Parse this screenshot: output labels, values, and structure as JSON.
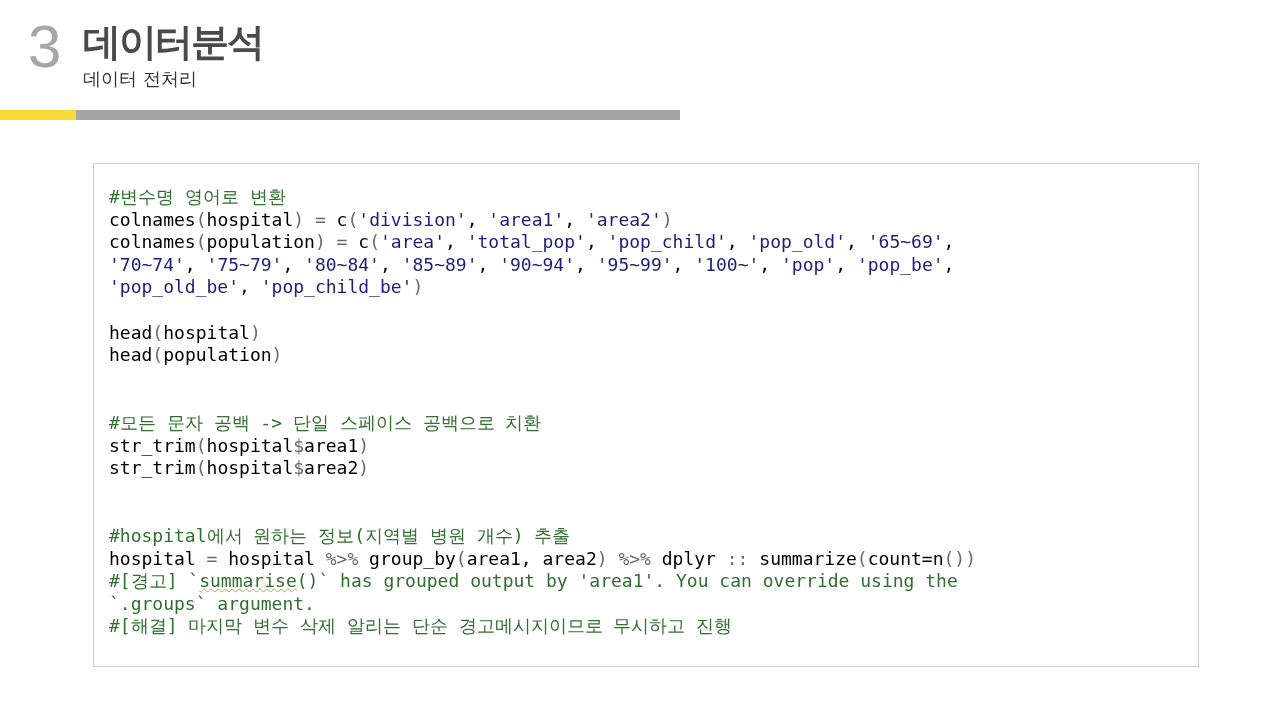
{
  "header": {
    "number": "3",
    "title": "데이터분석",
    "subtitle": "데이터 전처리"
  },
  "code": {
    "lines": [
      {
        "kind": "code",
        "tokens": [
          {
            "kind": "comment",
            "text": "#변수명 영어로 변환"
          }
        ]
      },
      {
        "kind": "code",
        "tokens": [
          {
            "kind": "plain",
            "text": "colnames"
          },
          {
            "kind": "op",
            "text": "("
          },
          {
            "kind": "plain",
            "text": "hospital"
          },
          {
            "kind": "op",
            "text": ") = "
          },
          {
            "kind": "plain",
            "text": "c"
          },
          {
            "kind": "op",
            "text": "("
          },
          {
            "kind": "string",
            "text": "'division'"
          },
          {
            "kind": "plain",
            "text": ", "
          },
          {
            "kind": "string",
            "text": "'area1'"
          },
          {
            "kind": "plain",
            "text": ", "
          },
          {
            "kind": "string",
            "text": "'area2'"
          },
          {
            "kind": "op",
            "text": ")"
          }
        ]
      },
      {
        "kind": "code",
        "tokens": [
          {
            "kind": "plain",
            "text": "colnames"
          },
          {
            "kind": "op",
            "text": "("
          },
          {
            "kind": "plain",
            "text": "population"
          },
          {
            "kind": "op",
            "text": ") = "
          },
          {
            "kind": "plain",
            "text": "c"
          },
          {
            "kind": "op",
            "text": "("
          },
          {
            "kind": "string",
            "text": "'area'"
          },
          {
            "kind": "plain",
            "text": ", "
          },
          {
            "kind": "string",
            "text": "'total_pop'"
          },
          {
            "kind": "plain",
            "text": ", "
          },
          {
            "kind": "string",
            "text": "'pop_child'"
          },
          {
            "kind": "plain",
            "text": ", "
          },
          {
            "kind": "string",
            "text": "'pop_old'"
          },
          {
            "kind": "plain",
            "text": ", "
          },
          {
            "kind": "string",
            "text": "'65~69'"
          },
          {
            "kind": "plain",
            "text": ","
          }
        ]
      },
      {
        "kind": "code",
        "tokens": [
          {
            "kind": "string",
            "text": "'70~74'"
          },
          {
            "kind": "plain",
            "text": ", "
          },
          {
            "kind": "string",
            "text": "'75~79'"
          },
          {
            "kind": "plain",
            "text": ", "
          },
          {
            "kind": "string",
            "text": "'80~84'"
          },
          {
            "kind": "plain",
            "text": ", "
          },
          {
            "kind": "string",
            "text": "'85~89'"
          },
          {
            "kind": "plain",
            "text": ", "
          },
          {
            "kind": "string",
            "text": "'90~94'"
          },
          {
            "kind": "plain",
            "text": ", "
          },
          {
            "kind": "string",
            "text": "'95~99'"
          },
          {
            "kind": "plain",
            "text": ", "
          },
          {
            "kind": "string",
            "text": "'100~'"
          },
          {
            "kind": "plain",
            "text": ", "
          },
          {
            "kind": "string",
            "text": "'pop'"
          },
          {
            "kind": "plain",
            "text": ", "
          },
          {
            "kind": "string",
            "text": "'pop_be'"
          },
          {
            "kind": "plain",
            "text": ","
          }
        ]
      },
      {
        "kind": "code",
        "tokens": [
          {
            "kind": "string",
            "text": "'pop_old_be'"
          },
          {
            "kind": "plain",
            "text": ", "
          },
          {
            "kind": "string",
            "text": "'pop_child_be'"
          },
          {
            "kind": "op",
            "text": ")"
          }
        ]
      },
      {
        "kind": "blank"
      },
      {
        "kind": "code",
        "tokens": [
          {
            "kind": "plain",
            "text": "head"
          },
          {
            "kind": "op",
            "text": "("
          },
          {
            "kind": "plain",
            "text": "hospital"
          },
          {
            "kind": "op",
            "text": ")"
          }
        ]
      },
      {
        "kind": "code",
        "tokens": [
          {
            "kind": "plain",
            "text": "head"
          },
          {
            "kind": "op",
            "text": "("
          },
          {
            "kind": "plain",
            "text": "population"
          },
          {
            "kind": "op",
            "text": ")"
          }
        ]
      },
      {
        "kind": "blank"
      },
      {
        "kind": "blank"
      },
      {
        "kind": "code",
        "tokens": [
          {
            "kind": "comment",
            "text": "#모든 문자 공백 -> 단일 스페이스 공백으로 치환"
          }
        ]
      },
      {
        "kind": "code",
        "tokens": [
          {
            "kind": "plain",
            "text": "str_trim"
          },
          {
            "kind": "op",
            "text": "("
          },
          {
            "kind": "plain",
            "text": "hospital"
          },
          {
            "kind": "op",
            "text": "$"
          },
          {
            "kind": "plain",
            "text": "area1"
          },
          {
            "kind": "op",
            "text": ")"
          }
        ]
      },
      {
        "kind": "code",
        "tokens": [
          {
            "kind": "plain",
            "text": "str_trim"
          },
          {
            "kind": "op",
            "text": "("
          },
          {
            "kind": "plain",
            "text": "hospital"
          },
          {
            "kind": "op",
            "text": "$"
          },
          {
            "kind": "plain",
            "text": "area2"
          },
          {
            "kind": "op",
            "text": ")"
          }
        ]
      },
      {
        "kind": "blank"
      },
      {
        "kind": "blank"
      },
      {
        "kind": "code",
        "tokens": [
          {
            "kind": "comment",
            "text": "#hospital에서 원하는 정보(지역별 병원 개수) 추출"
          }
        ]
      },
      {
        "kind": "code",
        "tokens": [
          {
            "kind": "plain",
            "text": "hospital "
          },
          {
            "kind": "op",
            "text": "="
          },
          {
            "kind": "plain",
            "text": " hospital "
          },
          {
            "kind": "op",
            "text": "%>%"
          },
          {
            "kind": "plain",
            "text": " group_by"
          },
          {
            "kind": "op",
            "text": "("
          },
          {
            "kind": "plain",
            "text": "area1, area2"
          },
          {
            "kind": "op",
            "text": ") %>%"
          },
          {
            "kind": "plain",
            "text": " dplyr "
          },
          {
            "kind": "op",
            "text": "::"
          },
          {
            "kind": "plain",
            "text": " summarize"
          },
          {
            "kind": "op",
            "text": "("
          },
          {
            "kind": "plain",
            "text": "count=n"
          },
          {
            "kind": "op",
            "text": "())"
          }
        ]
      },
      {
        "kind": "code",
        "tokens": [
          {
            "kind": "comment",
            "text": "#[경고] `"
          },
          {
            "kind": "flagged",
            "text": "summarise"
          },
          {
            "kind": "comment",
            "text": "()` has grouped output by 'area1'. You can override using the"
          }
        ]
      },
      {
        "kind": "code",
        "tokens": [
          {
            "kind": "comment",
            "text": "`.groups` argument."
          }
        ]
      },
      {
        "kind": "code",
        "tokens": [
          {
            "kind": "comment",
            "text": "#[해결] 마지막 변수 삭제 알리는 단순 경고메시지이므로 무시하고 진행"
          }
        ]
      }
    ]
  }
}
